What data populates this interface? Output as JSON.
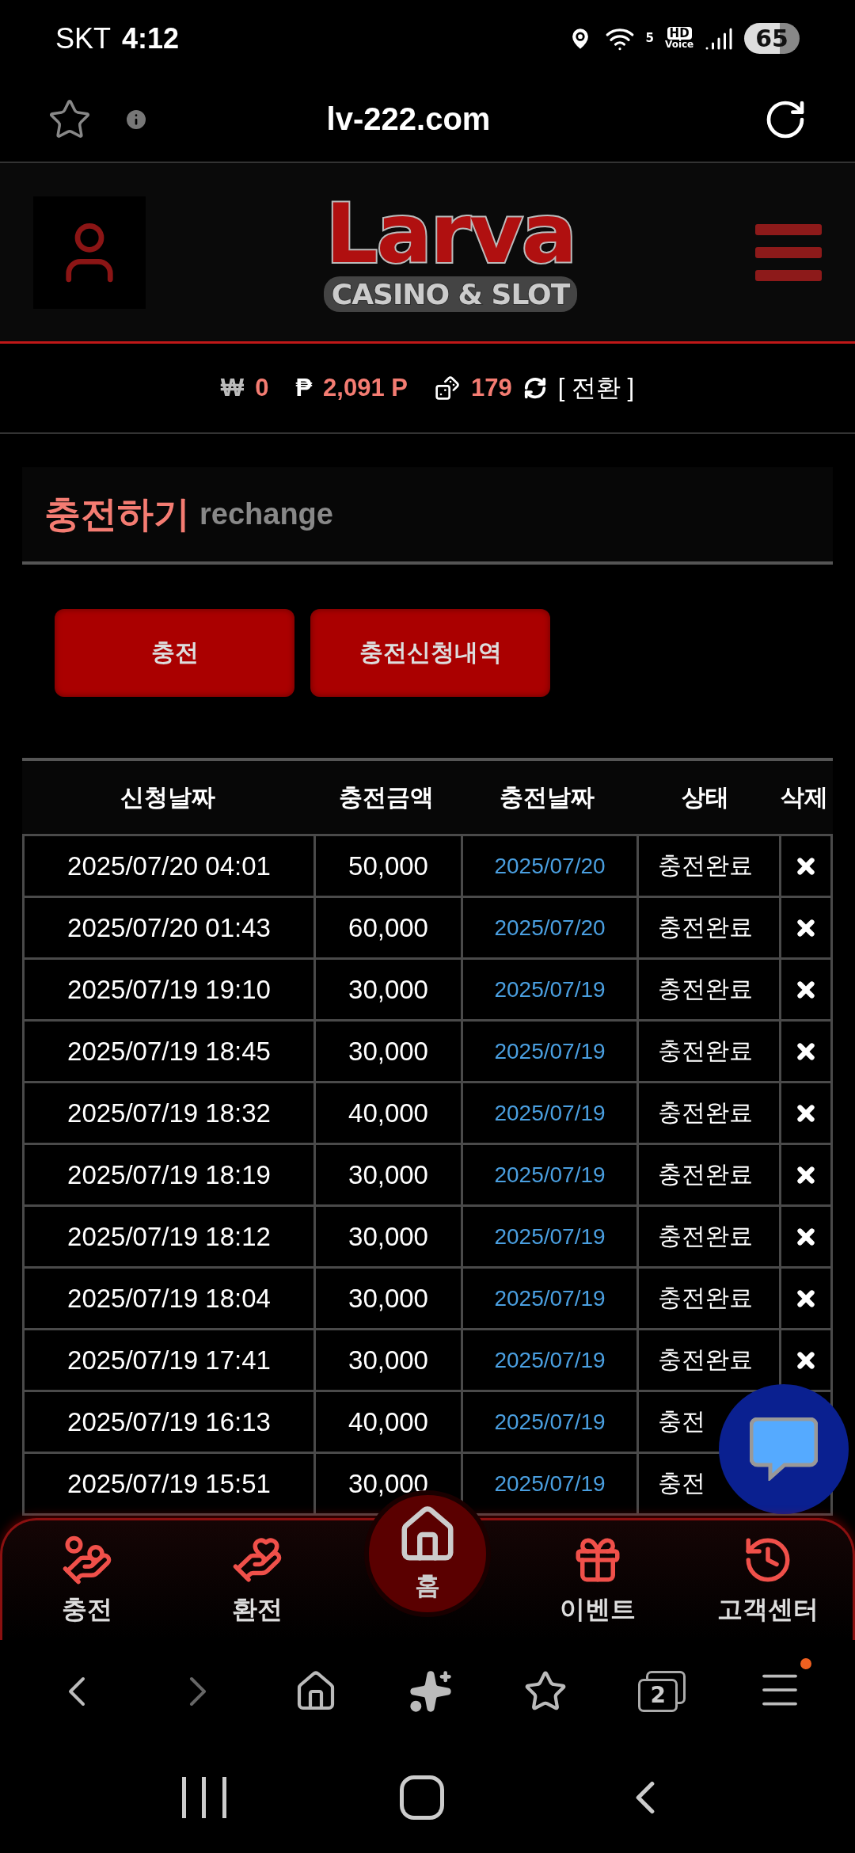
{
  "status_bar": {
    "carrier": "SKT",
    "time": "4:12",
    "wifi_band": "5",
    "hd_voice": [
      "HD",
      "Voice"
    ],
    "battery": "65"
  },
  "browser": {
    "url": "lv-222.com",
    "tab_count": "2"
  },
  "logo": {
    "title": "Larva",
    "subtitle": "CASINO & SLOT"
  },
  "balance": {
    "won_symbol": "₩",
    "won": "0",
    "point_symbol": "₱",
    "points": "2,091 P",
    "chips": "179",
    "convert": "[ 전환 ]"
  },
  "section": {
    "title": "충전하기",
    "subtitle": "rechange"
  },
  "actions": [
    {
      "label": "충전"
    },
    {
      "label": "충전신청내역"
    }
  ],
  "table": {
    "columns": [
      "신청날짜",
      "충전금액",
      "충전날짜",
      "상태",
      "삭제"
    ],
    "rows": [
      {
        "requested": "2025/07/20 04:01",
        "amount": "50,000",
        "charged": "2025/07/20",
        "status": "충전완료"
      },
      {
        "requested": "2025/07/20 01:43",
        "amount": "60,000",
        "charged": "2025/07/20",
        "status": "충전완료"
      },
      {
        "requested": "2025/07/19 19:10",
        "amount": "30,000",
        "charged": "2025/07/19",
        "status": "충전완료"
      },
      {
        "requested": "2025/07/19 18:45",
        "amount": "30,000",
        "charged": "2025/07/19",
        "status": "충전완료"
      },
      {
        "requested": "2025/07/19 18:32",
        "amount": "40,000",
        "charged": "2025/07/19",
        "status": "충전완료"
      },
      {
        "requested": "2025/07/19 18:19",
        "amount": "30,000",
        "charged": "2025/07/19",
        "status": "충전완료"
      },
      {
        "requested": "2025/07/19 18:12",
        "amount": "30,000",
        "charged": "2025/07/19",
        "status": "충전완료"
      },
      {
        "requested": "2025/07/19 18:04",
        "amount": "30,000",
        "charged": "2025/07/19",
        "status": "충전완료"
      },
      {
        "requested": "2025/07/19 17:41",
        "amount": "30,000",
        "charged": "2025/07/19",
        "status": "충전완료"
      },
      {
        "requested": "2025/07/19 16:13",
        "amount": "40,000",
        "charged": "2025/07/19",
        "status": "충전"
      },
      {
        "requested": "2025/07/19 15:51",
        "amount": "30,000",
        "charged": "2025/07/19",
        "status": "충전"
      }
    ]
  },
  "bottom_nav": [
    {
      "label": "충전",
      "selected": false
    },
    {
      "label": "환전",
      "selected": false
    },
    {
      "label": "홈",
      "selected": true
    },
    {
      "label": "이벤트",
      "selected": false
    },
    {
      "label": "고객센터",
      "selected": false
    }
  ]
}
